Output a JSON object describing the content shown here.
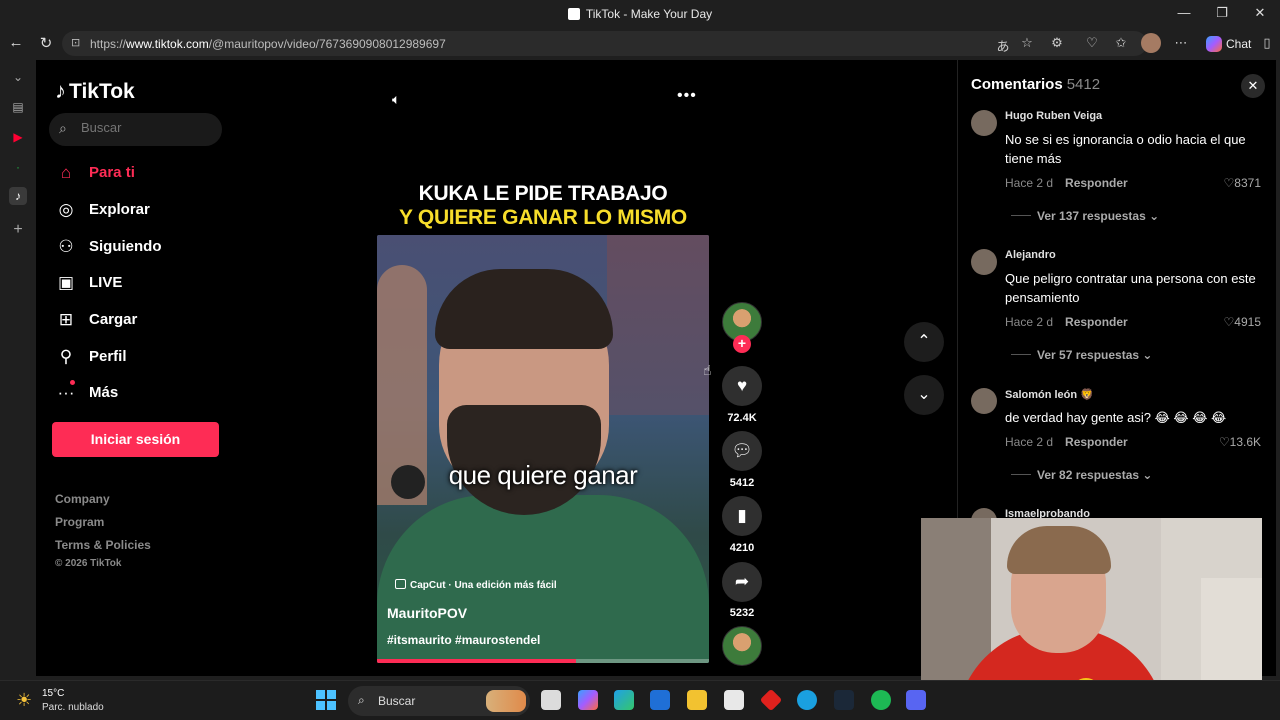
{
  "window": {
    "title": "TikTok - Make Your Day"
  },
  "browser": {
    "url_prefix": "https://",
    "url_host": "www.tiktok.com",
    "url_path": "/@mauritopov/video/7673690908012989697",
    "chat_label": "Chat"
  },
  "sidebar": {
    "logo": "TikTok",
    "search_placeholder": "Buscar",
    "nav": [
      {
        "label": "Para ti",
        "icon": "home-icon"
      },
      {
        "label": "Explorar",
        "icon": "compass-icon"
      },
      {
        "label": "Siguiendo",
        "icon": "following-icon"
      },
      {
        "label": "LIVE",
        "icon": "live-icon"
      },
      {
        "label": "Cargar",
        "icon": "upload-icon"
      },
      {
        "label": "Perfil",
        "icon": "profile-icon"
      },
      {
        "label": "Más",
        "icon": "more-icon"
      }
    ],
    "login_label": "Iniciar sesión",
    "footer": [
      "Company",
      "Program",
      "Terms & Policies"
    ],
    "copyright": "© 2026 TikTok"
  },
  "video": {
    "headline_line1": "KUKA LE PIDE TRABAJO",
    "headline_line2": "Y QUIERE GANAR LO MISMO",
    "caption": "que quiere ganar",
    "capcut": "CapCut · Una edición más fácil",
    "author": "MauritoPOV",
    "hashtags": "#itsmaurito #maurostendel",
    "progress": 0.6,
    "likes": "72.4K",
    "comments": "5412",
    "saves": "4210",
    "shares": "5232"
  },
  "comments_panel": {
    "title": "Comentarios",
    "count": "5412",
    "items": [
      {
        "name": "Hugo Ruben Veiga",
        "text": "No se si es ignorancia o odio hacia el que tiene más",
        "time": "Hace 2 d",
        "reply": "Responder",
        "likes": "8371",
        "more": "Ver 137 respuestas"
      },
      {
        "name": "Alejandro",
        "text": "Que peligro contratar una persona con este pensamiento",
        "time": "Hace 2 d",
        "reply": "Responder",
        "likes": "4915",
        "more": "Ver 57 respuestas"
      },
      {
        "name": "Salomón león 🦁",
        "text": "de verdad hay gente asi? 😂 😂 😂 😂",
        "time": "Hace 2 d",
        "reply": "Responder",
        "likes": "13.6K",
        "more": "Ver 82 respuestas"
      },
      {
        "name": "Ismaelprobando",
        "text": "",
        "time": "",
        "reply": "",
        "likes": "",
        "more": ""
      }
    ]
  },
  "taskbar": {
    "temp": "15°C",
    "condition": "Parc. nublado",
    "search_label": "Buscar"
  }
}
